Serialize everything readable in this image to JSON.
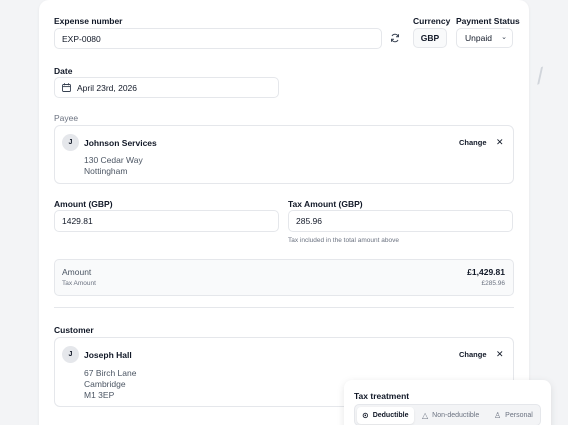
{
  "form": {
    "expense_number_label": "Expense number",
    "expense_number_value": "EXP-0080",
    "currency_label": "Currency",
    "currency_value": "GBP",
    "payment_status_label": "Payment Status",
    "payment_status_value": "Unpaid",
    "date_label": "Date",
    "date_value": "April 23rd, 2026",
    "payee_label": "Payee",
    "payee": {
      "initial": "J",
      "name": "Johnson Services",
      "address_line1": "130 Cedar Way",
      "address_line2": "Nottingham",
      "change_label": "Change",
      "remove_glyph": "✕"
    },
    "amount_label": "Amount (GBP)",
    "amount_value": "1429.81",
    "tax_amount_label": "Tax Amount (GBP)",
    "tax_amount_value": "285.96",
    "tax_hint": "Tax included in the total amount above",
    "summary": {
      "amount_label": "Amount",
      "amount_value": "£1,429.81",
      "tax_label": "Tax Amount",
      "tax_value": "£285.96"
    },
    "customer_label": "Customer",
    "customer": {
      "initial": "J",
      "name": "Joseph Hall",
      "address_line1": "67 Birch Lane",
      "address_line2": "Cambridge",
      "address_line3": "M1 3EP",
      "change_label": "Change",
      "remove_glyph": "✕"
    }
  },
  "tax_treatment": {
    "title": "Tax treatment",
    "options": [
      {
        "label": "Deductible",
        "icon": "check-circle-icon",
        "active": true
      },
      {
        "label": "Non-deductible",
        "icon": "warning-triangle-icon",
        "active": false
      },
      {
        "label": "Personal",
        "icon": "person-icon",
        "active": false
      }
    ]
  }
}
